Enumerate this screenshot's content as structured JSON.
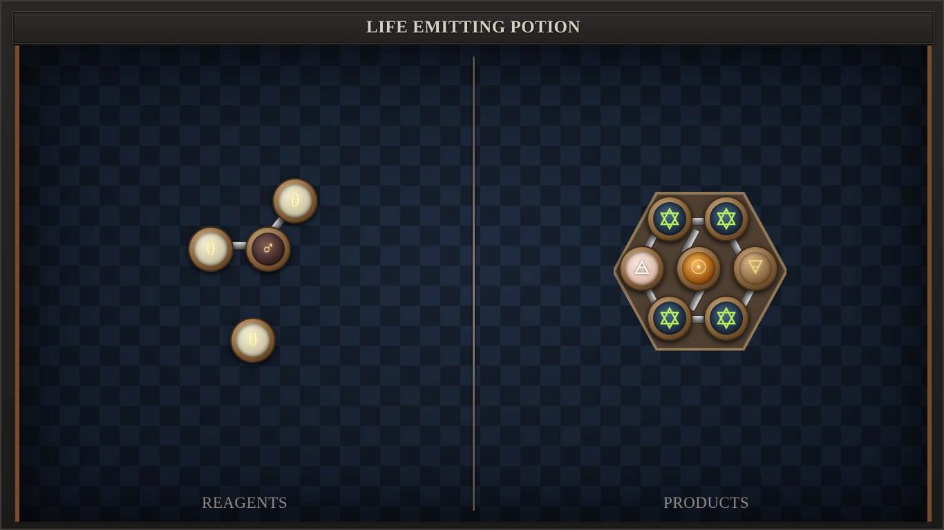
{
  "title": "LIFE EMITTING POTION",
  "sections": {
    "reagents_label": "REAGENTS",
    "products_label": "PRODUCTS"
  },
  "colors": {
    "board_background": "#172233",
    "frame_accent": "#7a4b2a",
    "title_text": "#d6cfc4",
    "label_text": "#8d8a86"
  },
  "reagents": {
    "molecules": [
      {
        "atoms": [
          "salt",
          "iron",
          "salt"
        ],
        "bonds": 2
      },
      {
        "atoms": [
          "salt"
        ],
        "bonds": 0
      }
    ],
    "glyphs": {
      "salt": "θ",
      "iron": "♂"
    }
  },
  "products": {
    "molecules": [
      {
        "atoms": [
          "vitae",
          "vitae",
          "air",
          "gold",
          "earth",
          "vitae",
          "vitae"
        ],
        "bonds": 6
      }
    ],
    "glyphs": {
      "gold": "☉",
      "air": "🜁",
      "earth": "🜃",
      "vitae": "✡"
    }
  }
}
